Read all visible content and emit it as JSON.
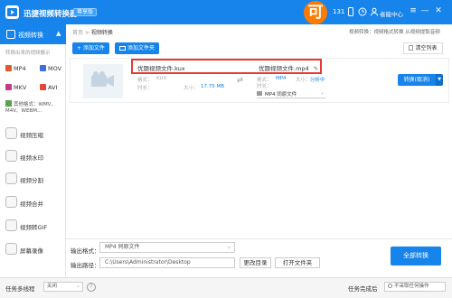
{
  "app": {
    "title": "迅捷视频转换器",
    "vip": "尊享版",
    "promo": "可",
    "user_id": "131",
    "login": "者能中心",
    "colors": {
      "primary": "#1684ea",
      "promo": "#ff7a00",
      "highlight": "#e53935"
    }
  },
  "window": {
    "min": "—",
    "max": "□",
    "close": "✕"
  },
  "sidebar": {
    "convert_title": "视频转换",
    "convert_arrow": "▲",
    "formats_hint": "转换出来的视频展示",
    "formats": [
      {
        "label": "MP4",
        "color": "#e05a2b"
      },
      {
        "label": "MOV",
        "color": "#3d6fd8"
      },
      {
        "label": "MKV",
        "color": "#c43a8a"
      },
      {
        "label": "AVI",
        "color": "#e3463a"
      }
    ],
    "other_formats": "其他格式：WMV、M4V、WEBM...",
    "items": [
      {
        "label": "视频压缩"
      },
      {
        "label": "视频水印"
      },
      {
        "label": "视频分割"
      },
      {
        "label": "视频合并"
      },
      {
        "label": "视频转GIF"
      },
      {
        "label": "屏幕录像"
      }
    ],
    "more": "任务多线程"
  },
  "breadcrumb": {
    "home": "首页",
    "sep": ">",
    "current": "视频转换"
  },
  "hint": "视频转换：视频格式转换 从视频提取音频",
  "toolbar": {
    "add_file": "+ 添加文件",
    "add_folder": "添加文件夹",
    "clear": "清空列表"
  },
  "file": {
    "src_name": "优题视频文件.kux",
    "dst_name": "优题视频文件.mp4",
    "src_format_label": "格式：",
    "src_format": "KUX",
    "src_duration_label": "时长：",
    "src_duration": "",
    "src_size_label": "大小：",
    "src_size": "17.75 MB",
    "dst_format_label": "格式：",
    "dst_format": "MP4",
    "dst_size_label": "大小：",
    "dst_size": "分析中",
    "dst_duration_label": "时长：",
    "output_select": "MP4 同原文件",
    "convert_btn": "转换(取消)",
    "convert_arrow": "▼"
  },
  "bottom": {
    "output_format_label": "输出格式：",
    "output_format": "MP4 同原文件",
    "output_path_label": "输出路径：",
    "output_path": "C:\\Users\\Administrator\\Desktop",
    "change_dir": "更改目录",
    "open_folder": "打开文件夹",
    "convert_all": "全部转换"
  },
  "statusbar": {
    "multi_thread_label": "任务多线程",
    "multi_thread": "关闭",
    "done_label": "任务完成后",
    "done_action": "不采取任何操作"
  }
}
